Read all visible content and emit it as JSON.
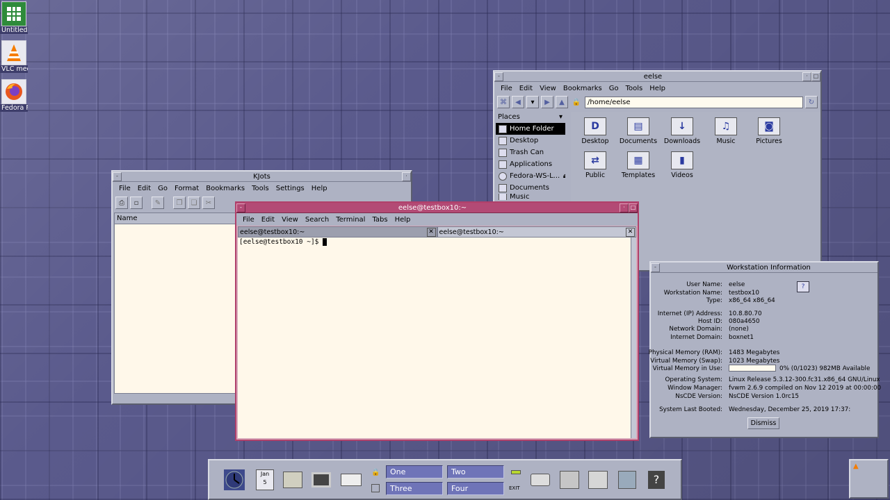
{
  "desktop_icons": [
    {
      "label": "Untitled",
      "icon": "spreadsheet-icon"
    },
    {
      "label": "VLC med",
      "icon": "vlc-icon"
    },
    {
      "label": "Fedora F",
      "icon": "firefox-icon"
    }
  ],
  "file_manager": {
    "title": "eelse",
    "menu": [
      "File",
      "Edit",
      "View",
      "Bookmarks",
      "Go",
      "Tools",
      "Help"
    ],
    "location": "/home/eelse",
    "places_header": "Places",
    "places": [
      "Home Folder",
      "Desktop",
      "Trash Can",
      "Applications",
      "Fedora-WS-L...",
      "Documents",
      "Music"
    ],
    "items": [
      "Desktop",
      "Documents",
      "Downloads",
      "Music",
      "Pictures",
      "Public",
      "Templates",
      "Videos"
    ]
  },
  "kjots": {
    "title": "KJots",
    "menu": [
      "File",
      "Edit",
      "Go",
      "Format",
      "Bookmarks",
      "Tools",
      "Settings",
      "Help"
    ],
    "column_header": "Name"
  },
  "terminal": {
    "title": "eelse@testbox10:~",
    "menu": [
      "File",
      "Edit",
      "View",
      "Search",
      "Terminal",
      "Tabs",
      "Help"
    ],
    "tabs": [
      "eelse@testbox10:~",
      "eelse@testbox10:~"
    ],
    "prompt": "[eelse@testbox10 ~]$ "
  },
  "workstation": {
    "title": "Workstation Information",
    "rows": [
      {
        "k": "User Name:",
        "v": "eelse"
      },
      {
        "k": "Workstation Name:",
        "v": "testbox10"
      },
      {
        "k": "Type:",
        "v": "x86_64 x86_64"
      },
      {
        "k": "Internet (IP) Address:",
        "v": "10.8.80.70"
      },
      {
        "k": "Host ID:",
        "v": "080a4650"
      },
      {
        "k": "Network Domain:",
        "v": "(none)"
      },
      {
        "k": "Internet Domain:",
        "v": "boxnet1"
      },
      {
        "k": "Physical Memory (RAM):",
        "v": "1483 Megabytes"
      },
      {
        "k": "Virtual Memory (Swap):",
        "v": "1023 Megabytes"
      },
      {
        "k": "Virtual Memory in Use:",
        "v": "0% (0/1023) 982MB Available"
      },
      {
        "k": "Operating System:",
        "v": "Linux Release 5.3.12-300.fc31.x86_64 GNU/Linux"
      },
      {
        "k": "Window Manager:",
        "v": "fvwm 2.6.9 compiled on Nov 12 2019 at 00:00:00"
      },
      {
        "k": "NsCDE Version:",
        "v": "NsCDE Version 1.0rc15"
      },
      {
        "k": "System Last Booted:",
        "v": "Wednesday, December 25, 2019 17:37:"
      }
    ],
    "swap_used_fraction": 0.0,
    "dismiss": "Dismiss"
  },
  "panel": {
    "date_month": "Jan",
    "date_day": "5",
    "workspaces": [
      "One",
      "Two",
      "Three",
      "Four"
    ],
    "exit_label": "EXIT"
  },
  "colors": {
    "desktop": "#5a5a8c",
    "window": "#aeb2c3",
    "terminal_accent": "#b34a75",
    "workspace": "#6f74b8"
  }
}
